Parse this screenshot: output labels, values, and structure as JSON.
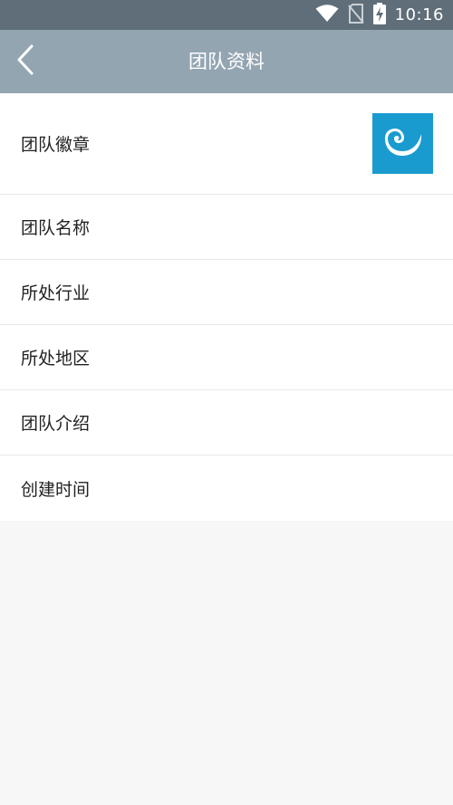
{
  "status_bar": {
    "time": "10:16",
    "icons": [
      "wifi-icon",
      "no-sim-icon",
      "battery-charging-icon"
    ]
  },
  "app_bar": {
    "title": "团队资料",
    "back_icon": "chevron-left-icon"
  },
  "rows": [
    {
      "label": "团队徽章"
    },
    {
      "label": "团队名称"
    },
    {
      "label": "所处行业"
    },
    {
      "label": "所处地区"
    },
    {
      "label": "团队介绍"
    },
    {
      "label": "创建时间"
    }
  ],
  "badge": {
    "icon": "team-logo-icon",
    "background": "#1a9bd0"
  },
  "colors": {
    "status_bar": "#5f6e78",
    "app_bar": "#94a5b2",
    "page_background": "#f7f7f7"
  }
}
